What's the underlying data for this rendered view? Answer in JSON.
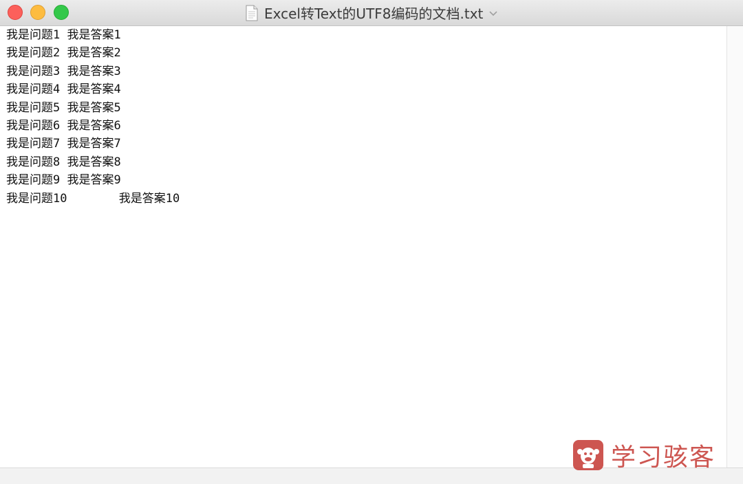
{
  "window": {
    "title": "Excel转Text的UTF8编码的文档.txt"
  },
  "document": {
    "lines": [
      "我是问题1 我是答案1",
      "我是问题2 我是答案2",
      "我是问题3 我是答案3",
      "我是问题4 我是答案4",
      "我是问题5 我是答案5",
      "我是问题6 我是答案6",
      "我是问题7 我是答案7",
      "我是问题8 我是答案8",
      "我是问题9 我是答案9",
      "我是问题10\t我是答案10"
    ]
  },
  "watermark": {
    "text": "学习骇客"
  },
  "colors": {
    "close": "#fc605b",
    "minimize": "#fdbc40",
    "zoom": "#34c84a",
    "watermark": "#c8443f"
  }
}
